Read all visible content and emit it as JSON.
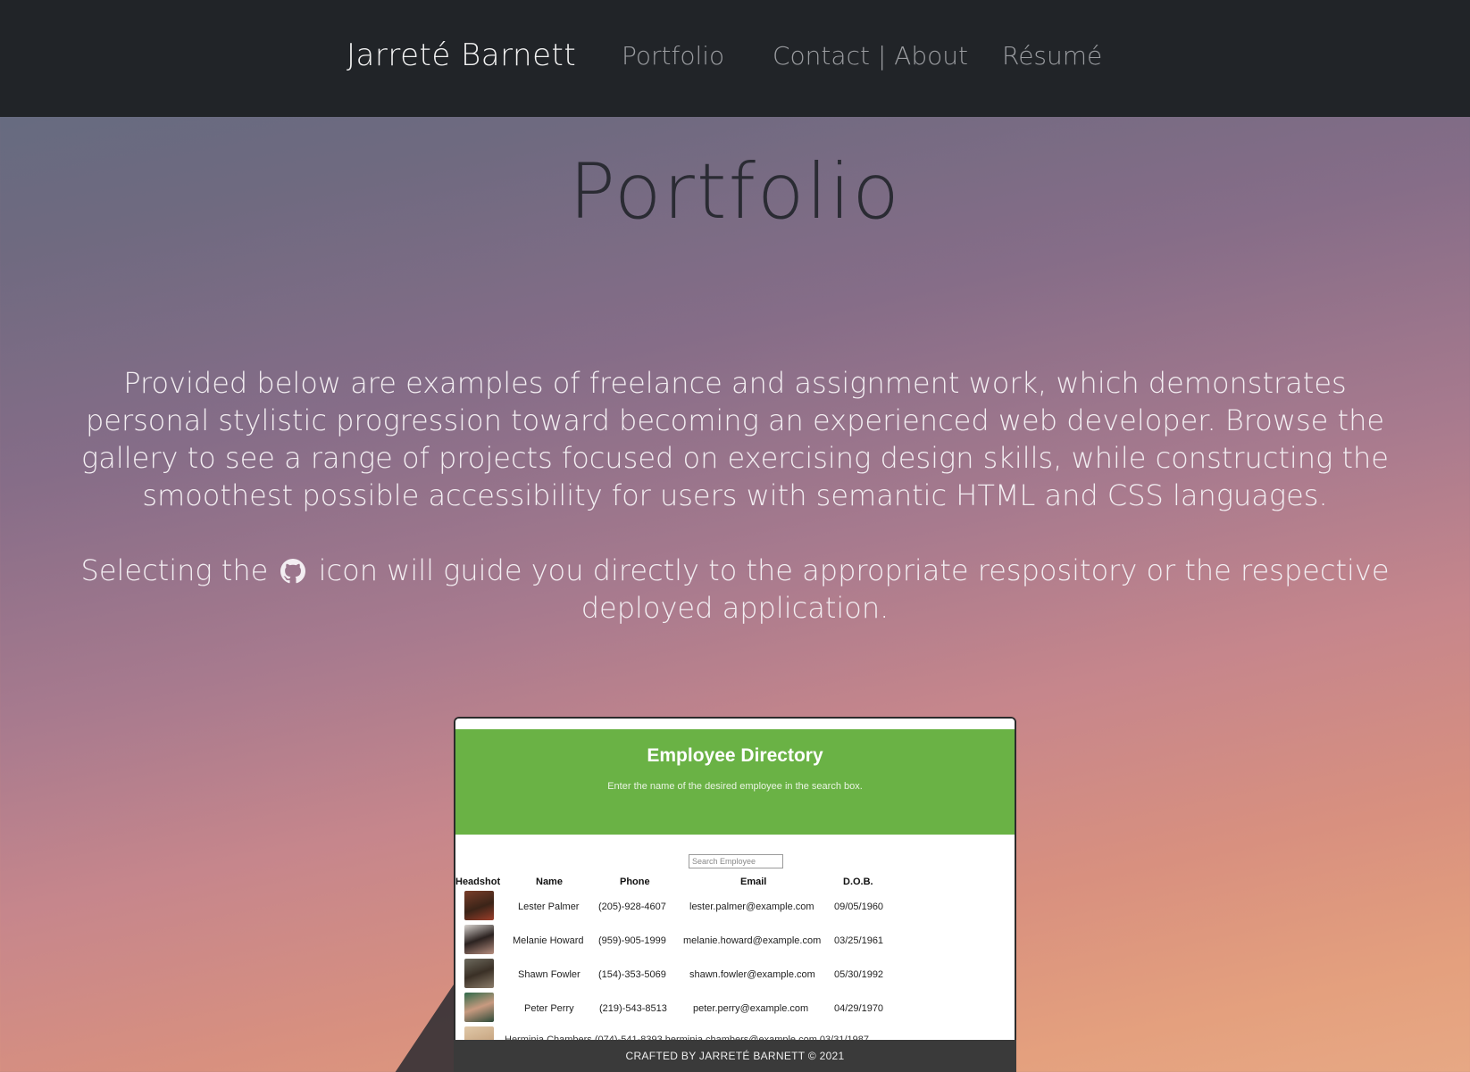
{
  "navbar": {
    "brand": "Jarreté Barnett",
    "links": [
      "Portfolio",
      "Contact | About",
      "Résumé"
    ]
  },
  "page": {
    "title": "Portfolio",
    "intro": "Provided below are examples of freelance and assignment work, which demonstrates personal stylistic progression toward becoming an experienced web developer. Browse the gallery to see a range of projects focused on exercising design skills, while constructing the smoothest possible accessibility for users with semantic HTML and CSS languages.",
    "selecting_before": "Selecting the",
    "selecting_after": "icon will guide you directly to the appropriate respository or the respective deployed application.",
    "github_icon": "github-icon"
  },
  "project_card": {
    "title": "Employee Directory",
    "subtitle": "Enter the name of the desired employee in the search box.",
    "search_placeholder": "Search Employee",
    "headers": [
      "Headshot",
      "Name",
      "Phone",
      "Email",
      "D.O.B."
    ],
    "rows": [
      {
        "name": "Lester Palmer",
        "phone": "(205)-928-4607",
        "email": "lester.palmer@example.com",
        "dob": "09/05/1960"
      },
      {
        "name": "Melanie Howard",
        "phone": "(959)-905-1999",
        "email": "melanie.howard@example.com",
        "dob": "03/25/1961"
      },
      {
        "name": "Shawn Fowler",
        "phone": "(154)-353-5069",
        "email": "shawn.fowler@example.com",
        "dob": "05/30/1992"
      },
      {
        "name": "Peter Perry",
        "phone": "(219)-543-8513",
        "email": "peter.perry@example.com",
        "dob": "04/29/1970"
      }
    ],
    "partial_row": "Herminia Chambers (074)-541-8393 herminia.chambers@example.com 03/31/1987",
    "accent_color": "#6ab245"
  },
  "footer": {
    "text": "CRAFTED BY JARRETÉ BARNETT © 2021"
  }
}
